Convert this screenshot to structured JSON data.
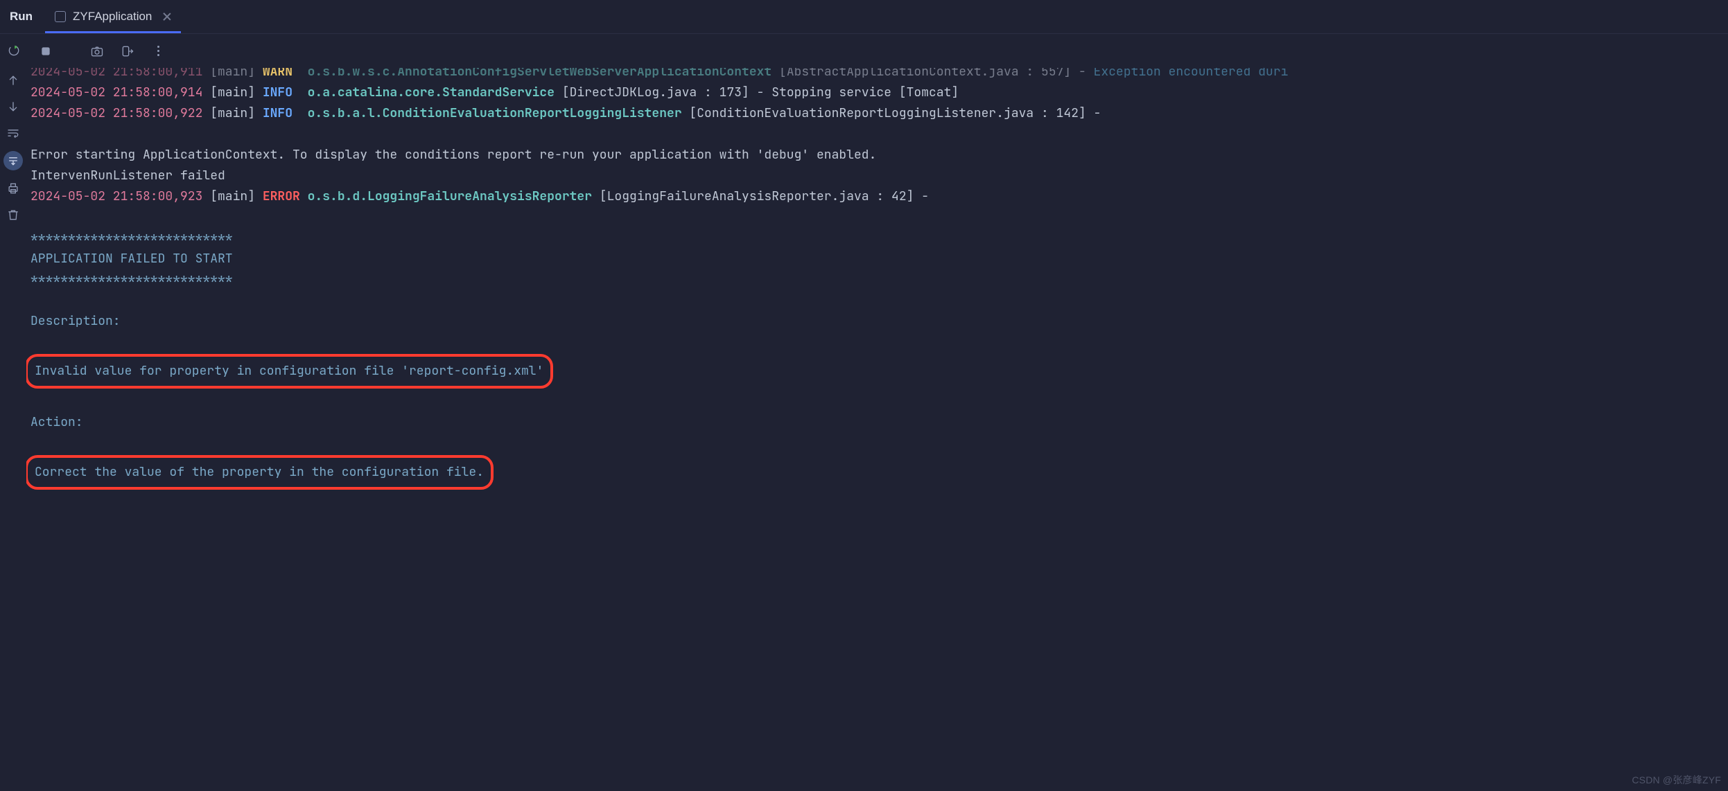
{
  "tabs": {
    "panel_title": "Run",
    "active": {
      "label": "ZYFApplication"
    }
  },
  "console": {
    "lines": [
      {
        "ts": "2024-05-02 21:58:00,911",
        "thread": "[main]",
        "level": "WARN",
        "logger": "o.s.b.w.s.c.AnnotationConfigServletWebServerApplicationContext",
        "rest": "[AbstractApplicationContext.java : 557] - ",
        "link": "Exception encountered duri"
      },
      {
        "ts": "2024-05-02 21:58:00,914",
        "thread": "[main]",
        "level": "INFO",
        "logger": "o.a.catalina.core.StandardService",
        "rest": "[DirectJDKLog.java : 173] - Stopping service [Tomcat]"
      },
      {
        "ts": "2024-05-02 21:58:00,922",
        "thread": "[main]",
        "level": "INFO",
        "logger": "o.s.b.a.l.ConditionEvaluationReportLoggingListener",
        "rest": "[ConditionEvaluationReportLoggingListener.java : 142] -"
      },
      {
        "plain": ""
      },
      {
        "plain": "Error starting ApplicationContext. To display the conditions report re-run your application with 'debug' enabled."
      },
      {
        "plain": "IntervenRunListener failed"
      },
      {
        "ts": "2024-05-02 21:58:00,923",
        "thread": "[main]",
        "level": "ERROR",
        "logger": "o.s.b.d.LoggingFailureAnalysisReporter",
        "rest": "[LoggingFailureAnalysisReporter.java : 42] -"
      },
      {
        "plain": ""
      },
      {
        "analysis": "***************************"
      },
      {
        "analysis": "APPLICATION FAILED TO START"
      },
      {
        "analysis": "***************************"
      },
      {
        "plain": ""
      },
      {
        "analysis": "Description:"
      },
      {
        "plain": ""
      },
      {
        "analysis_hl": "Invalid value for property in configuration file 'report-config.xml'"
      },
      {
        "plain": ""
      },
      {
        "analysis": "Action:"
      },
      {
        "plain": ""
      },
      {
        "analysis_hl": "Correct the value of the property in the configuration file."
      }
    ]
  },
  "watermark": "CSDN @张彦峰ZYF"
}
